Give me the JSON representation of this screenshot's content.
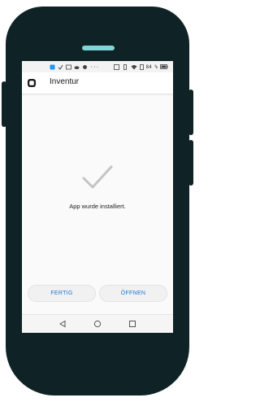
{
  "statusbar": {
    "left_icons": [
      "notification-icon",
      "check-icon",
      "image-icon",
      "cloud-icon",
      "settings-icon"
    ],
    "left_overflow": "···",
    "battery_percent": "84 %"
  },
  "app": {
    "title": "Inventur",
    "icon": "app-logo-icon"
  },
  "dialog": {
    "message": "App wurde installiert.",
    "icon": "checkmark-icon"
  },
  "buttons": {
    "done_label": "FERTIG",
    "open_label": "ÖFFNEN"
  },
  "navbar": {
    "icons": [
      "back-icon",
      "home-icon",
      "recent-apps-icon"
    ]
  },
  "colors": {
    "frame": "#0f2225",
    "speaker": "#7fd6d6",
    "accent": "#1976d2",
    "checkmark": "#c4c4c4"
  }
}
